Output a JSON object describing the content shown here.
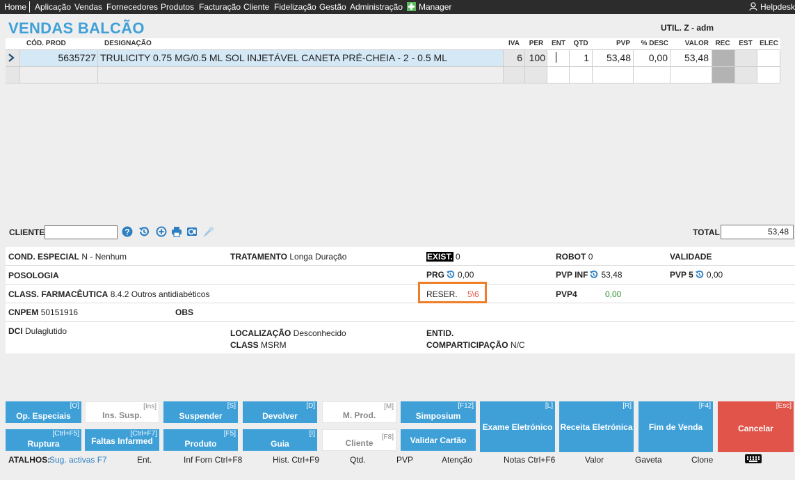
{
  "topnav": {
    "items": [
      "Home",
      "Aplicação",
      "Vendas",
      "Fornecedores",
      "Produtos",
      "Facturação",
      "Cliente",
      "Fidelização",
      "Gestão",
      "Administração",
      "Manager"
    ],
    "helpdesk": "Helpdesk"
  },
  "page": {
    "title": "VENDAS BALCÃO",
    "user": "UTIL. Z - adm"
  },
  "grid": {
    "headers": [
      "CÓD. PROD",
      "DESIGNAÇÃO",
      "IVA",
      "PER",
      "ENT",
      "QTD",
      "PVP",
      "% DESC",
      "VALOR",
      "REC",
      "EST",
      "ELEC"
    ],
    "rows": [
      {
        "cod": "5635727",
        "designacao": "TRULICITY 0.75 MG/0.5 ML SOL INJETÁVEL CANETA PRÉ-CHEIA - 2  - 0.5 ML",
        "iva": "6",
        "per": "100",
        "ent": "",
        "qtd": "1",
        "pvp": "53,48",
        "desc": "0,00",
        "valor": "53,48"
      }
    ]
  },
  "client": {
    "label": "CLIENTE",
    "value": "",
    "total_label": "TOTAL",
    "total": "53,48"
  },
  "toolbar_icons": [
    "help-icon",
    "history-icon",
    "add-icon",
    "print-icon",
    "card-icon",
    "syringe-icon"
  ],
  "info": {
    "cond_especial_label": "COND. ESPECIAL",
    "cond_especial": "N - Nenhum",
    "tratamento_label": "TRATAMENTO",
    "tratamento": "Longa Duração",
    "exist_label": "EXIST.",
    "exist": "0",
    "robot_label": "ROBOT",
    "robot": "0",
    "validade_label": "VALIDADE",
    "posologia_label": "POSOLOGIA",
    "prg_label": "PRG",
    "prg": "0,00",
    "pvp_inf_label": "PVP INF",
    "pvp_inf": "53,48",
    "pvp5_label": "PVP 5",
    "pvp5": "0,00",
    "class_farm_label": "CLASS. FARMACÊUTICA",
    "class_farm": "8.4.2 Outros antidiabéticos",
    "reser_label": "RESER.",
    "reser": "5\\6",
    "pvp4_label": "PVP4",
    "pvp4": "0,00",
    "cnpem_label": "CNPEM",
    "cnpem": "50151916",
    "obs_label": "OBS",
    "dci_label": "DCI",
    "dci": "Dulaglutido",
    "localizacao_label": "LOCALIZAÇÃO",
    "localizacao": "Desconhecido",
    "class_label": "CLASS",
    "class": "MSRM",
    "entid_label": "ENTID.",
    "comparticipacao_label": "COMPARTICIPAÇÃO",
    "comparticipacao": "N/C"
  },
  "buttons": {
    "op_especiais": {
      "label": "Op. Especiais",
      "key": "[O]"
    },
    "ins_susp": {
      "label": "Ins. Susp.",
      "key": "[Ins]"
    },
    "suspender": {
      "label": "Suspender",
      "key": "[S]"
    },
    "devolver": {
      "label": "Devolver",
      "key": "[D]"
    },
    "m_prod": {
      "label": "M. Prod.",
      "key": "[M]"
    },
    "simposium": {
      "label": "Simposium",
      "key": "[F12]"
    },
    "exame": {
      "label": "Exame Eletrónico",
      "key": "[L]"
    },
    "receita": {
      "label": "Receita Eletrónica",
      "key": "[R]"
    },
    "fim_venda": {
      "label": "Fim de Venda",
      "key": "[F4]"
    },
    "cancelar": {
      "label": "Cancelar",
      "key": "[Esc]"
    },
    "ruptura": {
      "label": "Ruptura",
      "key": "[Ctrl+F5]"
    },
    "faltas": {
      "label": "Faltas Infarmed",
      "key": "[Ctrl+F7]"
    },
    "produto": {
      "label": "Produto",
      "key": "[F5]"
    },
    "guia": {
      "label": "Guia",
      "key": "[I]"
    },
    "cliente": {
      "label": "Cliente",
      "key": "[F8]"
    },
    "validar": {
      "label": "Validar Cartão",
      "key": ""
    }
  },
  "shortcuts": {
    "atalhos": "ATALHOS:",
    "sug": "Sug. activas F7",
    "ent": "Ent.",
    "inf_forn": "Inf Forn Ctrl+F8",
    "hist": "Hist. Ctrl+F9",
    "qtd": "Qtd.",
    "pvp": "PVP",
    "atencao": "Atenção",
    "notas": "Notas Ctrl+F6",
    "valor": "Valor",
    "gaveta": "Gaveta",
    "clone": "Clone"
  },
  "colors": {
    "accent": "#3fa0d8",
    "cancel": "#e0544a",
    "highlight": "#f07e26",
    "selected_row": "#d4e8f5"
  }
}
